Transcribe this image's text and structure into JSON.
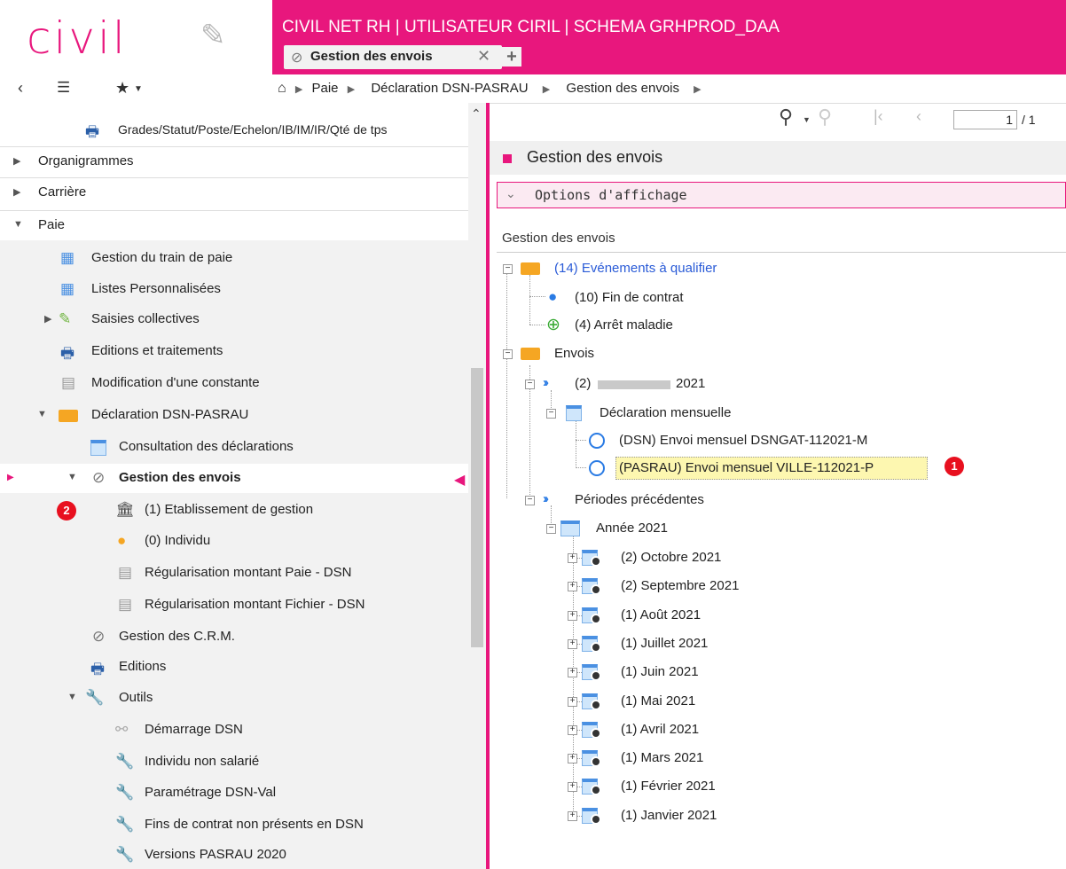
{
  "header": {
    "logo": "civil",
    "app_title": "CIVIL NET RH | UTILISATEUR CIRIL | SCHEMA GRHPROD_DAA",
    "tab_label": "Gestion des envois",
    "brand_color": "#e8177d"
  },
  "breadcrumb": [
    "Paie",
    "Déclaration DSN-PASRAU",
    "Gestion des envois"
  ],
  "pager": {
    "current": "1",
    "total": "/ 1"
  },
  "nav": {
    "grades_item": "Grades/Statut/Poste/Echelon/IB/IM/IR/Qté de tps",
    "organigrammes": "Organigrammes",
    "carriere": "Carrière",
    "paie": "Paie",
    "paie_items": [
      "Gestion du train de paie",
      "Listes Personnalisées",
      "Saisies collectives",
      "Editions et traitements",
      "Modification d'une constante",
      "Déclaration DSN-PASRAU",
      "Consultation des déclarations",
      "Gestion des envois",
      "(1) Etablissement de gestion",
      "(0) Individu",
      "Régularisation montant Paie - DSN",
      "Régularisation montant Fichier - DSN",
      "Gestion des C.R.M.",
      "Editions",
      "Outils",
      "Démarrage DSN",
      "Individu non salarié",
      "Paramétrage DSN-Val",
      "Fins de contrat non présents en DSN",
      "Versions PASRAU 2020"
    ],
    "badge2": "2"
  },
  "main": {
    "title": "Gestion des envois",
    "options": "Options d'affichage",
    "section_title": "Gestion des envois",
    "tree": {
      "evenements": "(14) Evénements à qualifier",
      "fin_contrat": "(10) Fin de contrat",
      "arret": "(4) Arrêt maladie",
      "envois": "Envois",
      "month_prefix": "(2)",
      "month_year": "2021",
      "decl_mensuelle": "Déclaration mensuelle",
      "dsn_envoi": "(DSN) Envoi mensuel DSNGAT-112021-M",
      "pasrau_envoi": "(PASRAU) Envoi mensuel VILLE-112021-P",
      "periodes": "Périodes précédentes",
      "annee": "Année 2021",
      "months": [
        "(2) Octobre 2021",
        "(2) Septembre 2021",
        "(1) Août 2021",
        "(1) Juillet 2021",
        "(1) Juin 2021",
        "(1) Mai 2021",
        "(1) Avril 2021",
        "(1) Mars 2021",
        "(1) Février 2021",
        "(1) Janvier 2021"
      ]
    },
    "badge1": "1"
  }
}
